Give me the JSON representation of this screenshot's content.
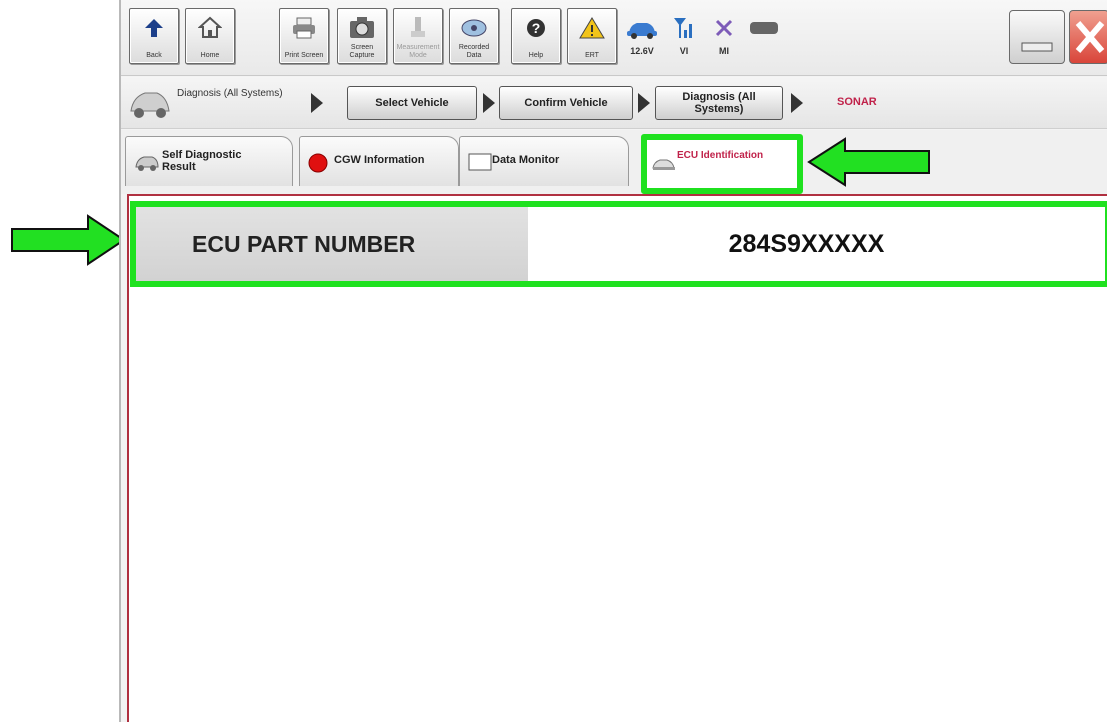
{
  "toolbar": {
    "buttons": [
      {
        "label": "Back",
        "icon": "back-arrow-icon"
      },
      {
        "label": "Home",
        "icon": "home-icon"
      },
      {
        "label": "Print Screen",
        "icon": "printer-icon"
      },
      {
        "label": "Screen Capture",
        "icon": "camera-icon"
      },
      {
        "label": "Measurement Mode",
        "icon": "measurement-icon"
      },
      {
        "label": "Recorded Data",
        "icon": "recorded-data-icon"
      },
      {
        "label": "Help",
        "icon": "help-icon"
      },
      {
        "label": "ERT",
        "icon": "warning-icon"
      }
    ],
    "status": [
      {
        "label": "12.6V",
        "icon": "car-battery-icon"
      },
      {
        "label": "VI",
        "icon": "signal-icon"
      },
      {
        "label": "MI",
        "icon": "mi-cross-icon"
      }
    ]
  },
  "breadcrumb": {
    "current_label": "Diagnosis (All Systems)",
    "steps": [
      "Select Vehicle",
      "Confirm Vehicle",
      "Diagnosis (All Systems)"
    ],
    "system": "SONAR"
  },
  "tabs": [
    {
      "label": "Self Diagnostic Result"
    },
    {
      "label": "CGW Information"
    },
    {
      "label": "Data Monitor"
    },
    {
      "label": "ECU Identification"
    }
  ],
  "ecu": {
    "label": "ECU PART NUMBER",
    "value": "284S9XXXXX"
  },
  "colors": {
    "highlight": "#1fe11f",
    "active_tab_text": "#c0224a",
    "system_text": "#c0224a",
    "close": "#d9453a"
  }
}
